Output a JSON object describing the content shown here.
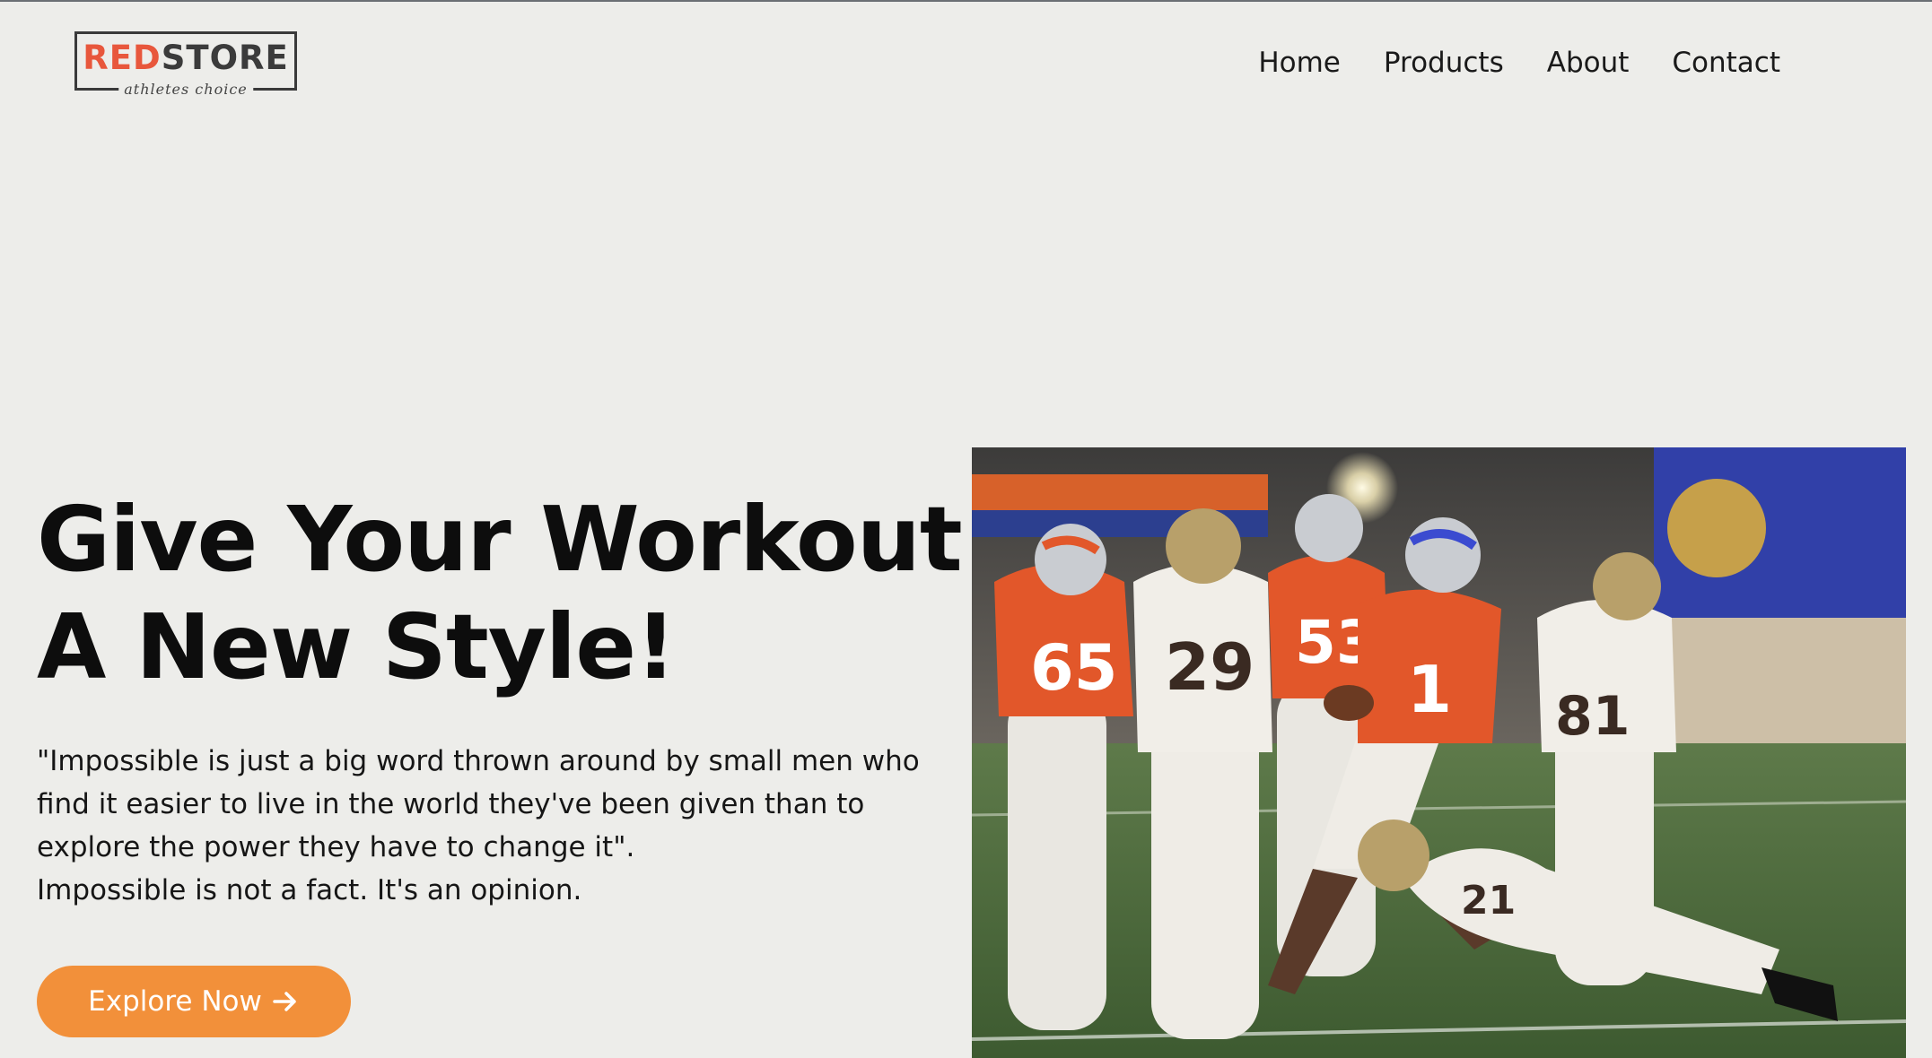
{
  "brand": {
    "logo_red": "RED",
    "logo_store": "STORE",
    "tagline": "athletes choice",
    "colors": {
      "red": "#e8573c",
      "dark": "#3b3b3b"
    }
  },
  "nav": {
    "items": [
      {
        "label": "Home"
      },
      {
        "label": "Products"
      },
      {
        "label": "About"
      },
      {
        "label": "Contact"
      }
    ]
  },
  "hero": {
    "title_line1": "Give Your Workout",
    "title_line2": "A New Style!",
    "quote_lines": [
      "\"Impossible is just a big word thrown around by small men who",
      "find it easier to live in the world they've been given than to",
      "explore the power they have to change it\".",
      "Impossible is not a fact. It's an opinion."
    ],
    "cta_label": "Explore Now",
    "cta_icon": "arrow-right-icon",
    "cta_color": "#f2903a"
  },
  "hero_image": {
    "icon": "football-players-photo",
    "players": [
      {
        "jersey": "65",
        "team": "orange"
      },
      {
        "jersey": "29",
        "team": "white"
      },
      {
        "jersey": "53",
        "team": "orange"
      },
      {
        "jersey": "1",
        "team": "orange"
      },
      {
        "jersey": "81",
        "team": "white"
      },
      {
        "jersey": "21",
        "team": "white"
      }
    ],
    "colors": {
      "field": "#4a6b3b",
      "orange": "#e2572a",
      "white": "#e9e7e1",
      "gold": "#b8a06a"
    }
  }
}
